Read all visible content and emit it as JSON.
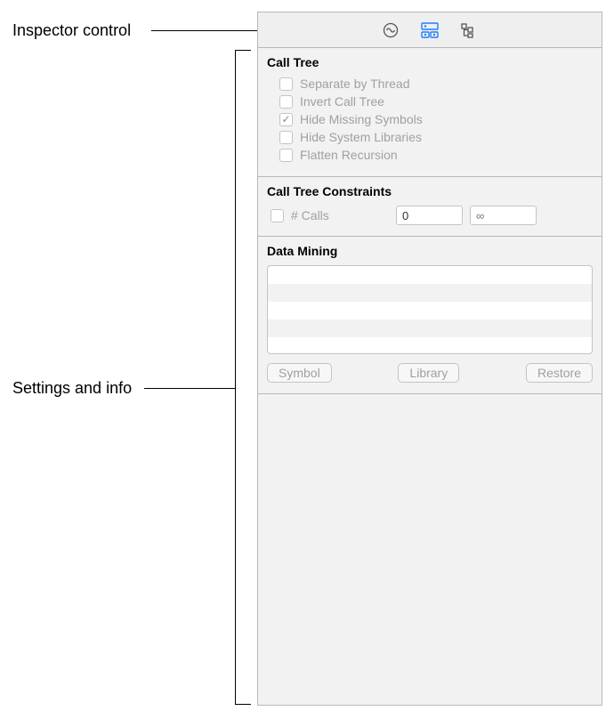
{
  "annotations": {
    "inspector_control": "Inspector control",
    "settings_and_info": "Settings and info"
  },
  "sections": {
    "call_tree": {
      "title": "Call Tree",
      "options": [
        {
          "label": "Separate by Thread",
          "checked": false
        },
        {
          "label": "Invert Call Tree",
          "checked": false
        },
        {
          "label": "Hide Missing Symbols",
          "checked": true
        },
        {
          "label": "Hide System Libraries",
          "checked": false
        },
        {
          "label": "Flatten Recursion",
          "checked": false
        }
      ]
    },
    "constraints": {
      "title": "Call Tree Constraints",
      "calls_label": "# Calls",
      "min_value": "0",
      "max_placeholder": "∞"
    },
    "data_mining": {
      "title": "Data Mining",
      "buttons": {
        "symbol": "Symbol",
        "library": "Library",
        "restore": "Restore"
      }
    }
  }
}
